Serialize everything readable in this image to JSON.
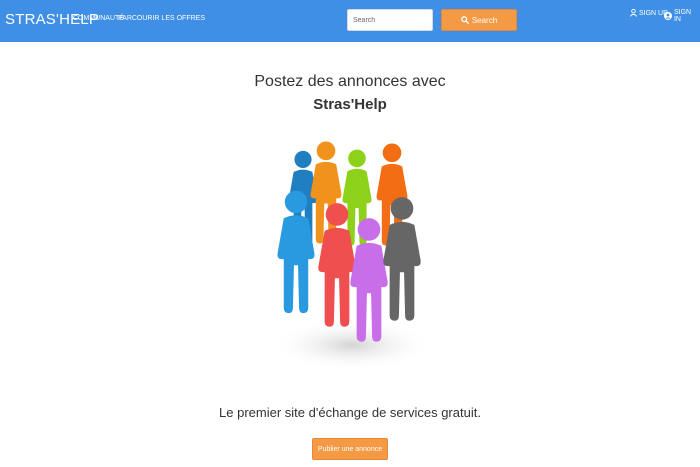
{
  "nav": {
    "brand": "STRAS'HELP",
    "links": [
      "COMMUNAUTÉ",
      "PARCOURIR LES OFFRES"
    ],
    "search_placeholder": "Search",
    "search_button": "Search",
    "signup": "SIGN UP",
    "signin": "SIGN IN"
  },
  "hero": {
    "line1": "Postez des annonces avec",
    "line2": "Stras'Help",
    "tagline": "Le premier site d'échange de services gratuit.",
    "cta": "Publier une annonce"
  },
  "colors": {
    "navbar": "#3f8fe6",
    "accent": "#f49a45"
  },
  "icons": {
    "search": "search-icon",
    "signup": "user-icon",
    "signin": "user-circle-icon"
  }
}
